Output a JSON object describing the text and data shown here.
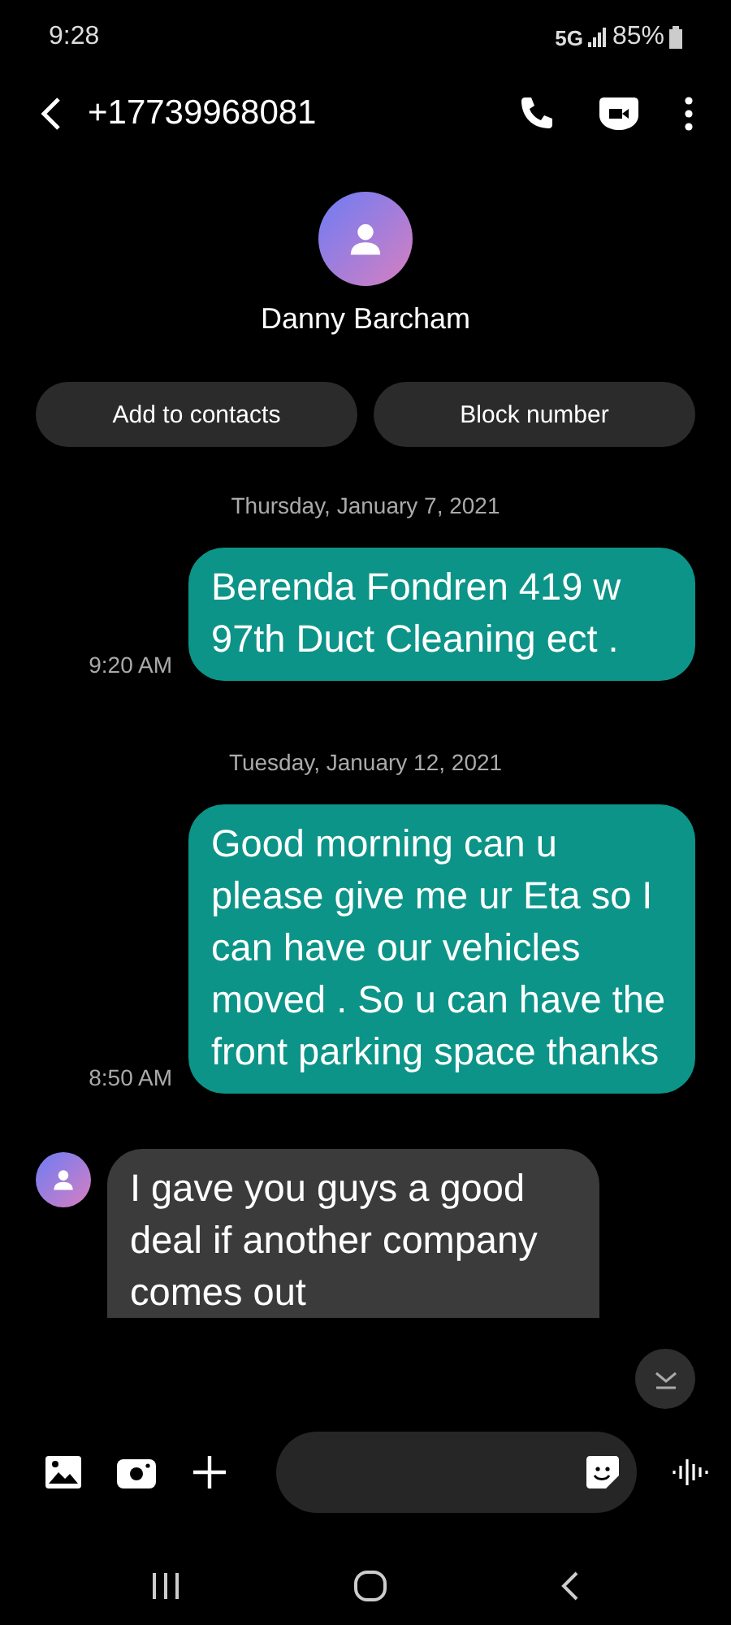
{
  "status_bar": {
    "time": "9:28",
    "network": "5G",
    "battery": "85%"
  },
  "header": {
    "title": "+17739968081"
  },
  "contact": {
    "name": "Danny Barcham"
  },
  "actions": [
    "Add to contacts",
    "Block number"
  ],
  "messages": [
    {
      "kind": "date",
      "text": "Thursday, January 7, 2021"
    },
    {
      "kind": "sent",
      "text": "Berenda Fondren 419 w 97th Duct Cleaning ect .",
      "time": "9:20 AM"
    },
    {
      "kind": "date",
      "text": "Tuesday, January 12, 2021"
    },
    {
      "kind": "sent",
      "text": "Good morning can u please give me ur Eta so I can have our vehicles moved . So u can have the front parking space thanks",
      "time": "8:50 AM"
    },
    {
      "kind": "received",
      "text": "I gave you guys a good deal if another company comes out"
    }
  ]
}
